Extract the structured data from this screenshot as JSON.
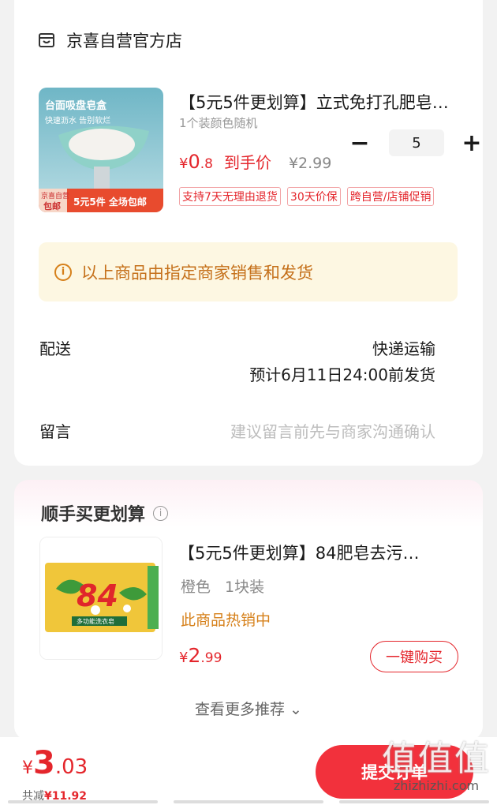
{
  "shop": {
    "name": "京喜自营官方店",
    "icon": "shop-icon"
  },
  "product": {
    "title": "【5元5件更划算】立式免打孔肥皂…",
    "spec": "1个装颜色随机",
    "price_symbol": "¥",
    "price_int": "0",
    "price_dec": ".8",
    "price_label": "到手价",
    "original_price": "¥2.99",
    "quantity": "5",
    "minus": "−",
    "plus": "+",
    "tags": [
      "支持7天无理由退货",
      "30天价保",
      "跨自营/店铺促销"
    ],
    "image_text": {
      "headline": "台面吸盘皂盒",
      "sub": "快速沥水 告别软烂",
      "badge1": "京喜自营",
      "badge1b": "包邮",
      "badge2": "5元5件 全场包邮"
    }
  },
  "notice": {
    "text": "以上商品由指定商家销售和发货",
    "icon": "info-icon"
  },
  "delivery": {
    "label": "配送",
    "method": "快递运输",
    "eta": "预计6月11日24:00前发货"
  },
  "message": {
    "label": "留言",
    "placeholder": "建议留言前先与商家沟通确认"
  },
  "recommend": {
    "section_title": "顺手买更划算",
    "title": "【5元5件更划算】84肥皂去污…",
    "color": "橙色",
    "pack": "1块装",
    "hot": "此商品热销中",
    "price_symbol": "¥",
    "price_int": "2",
    "price_dec": ".99",
    "buy_label": "一键购买",
    "more_label": "查看更多推荐 ⌄",
    "image_text": {
      "big": "84",
      "brand": "多功能洗衣皂"
    }
  },
  "footer": {
    "total_symbol": "¥",
    "total_int": "3",
    "total_dec": ".03",
    "saved_label": "共减",
    "saved_value": "¥11.92",
    "submit_label": "提交订单"
  },
  "watermark": {
    "big": "值值值",
    "small": "zhizhizhi.com"
  },
  "colors": {
    "accent": "#e4262c",
    "notice_bg": "#fdf7e2",
    "notice_text": "#c5701a"
  }
}
